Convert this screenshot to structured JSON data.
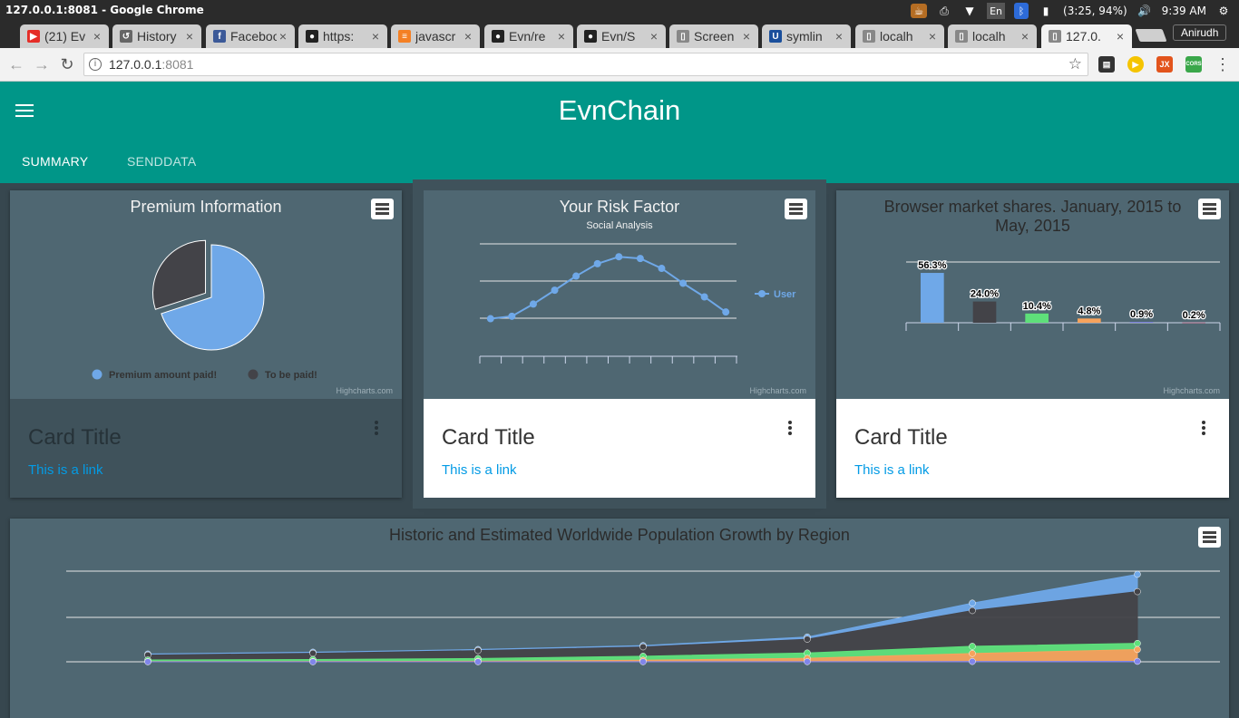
{
  "os": {
    "window_title": "127.0.0.1:8081 - Google Chrome",
    "keyboard": "En",
    "battery": "(3:25, 94%)",
    "clock": "9:39 AM"
  },
  "browser": {
    "tabs": [
      {
        "label": "(21) Ev",
        "icon": "youtube-icon",
        "color": "#e52d27",
        "glyph": "▶"
      },
      {
        "label": "History",
        "icon": "history-icon",
        "color": "#666666",
        "glyph": "↺"
      },
      {
        "label": "Facebook",
        "icon": "facebook-icon",
        "color": "#3b5998",
        "glyph": "f"
      },
      {
        "label": "https:",
        "icon": "github-icon",
        "color": "#222222",
        "glyph": "●"
      },
      {
        "label": "javascr",
        "icon": "stackoverflow-icon",
        "color": "#f48024",
        "glyph": "≡"
      },
      {
        "label": "Evn/re",
        "icon": "github-icon",
        "color": "#222222",
        "glyph": "●"
      },
      {
        "label": "Evn/S",
        "icon": "github-icon",
        "color": "#222222",
        "glyph": "●"
      },
      {
        "label": "Screen",
        "icon": "page-icon",
        "color": "#888888",
        "glyph": "▯"
      },
      {
        "label": "symlin",
        "icon": "unix-icon",
        "color": "#1a4f9c",
        "glyph": "U"
      },
      {
        "label": "localh",
        "icon": "page-icon",
        "color": "#888888",
        "glyph": "▯"
      },
      {
        "label": "localh",
        "icon": "page-icon",
        "color": "#888888",
        "glyph": "▯"
      },
      {
        "label": "127.0.",
        "icon": "page-icon",
        "color": "#888888",
        "glyph": "▯"
      }
    ],
    "profile": "Anirudh",
    "url_host": "127.0.0.1",
    "url_port": ":8081"
  },
  "app": {
    "title": "EvnChain",
    "tabs": [
      "SUMMARY",
      "SENDDATA"
    ]
  },
  "cards": [
    {
      "title": "Card Title",
      "link": "This is a link"
    },
    {
      "title": "Card Title",
      "link": "This is a link"
    },
    {
      "title": "Card Title",
      "link": "This is a link"
    }
  ],
  "credits": "Highcharts.com",
  "chart_data": [
    {
      "type": "pie",
      "title": "Premium Information",
      "categories": [
        "Premium amount paid!",
        "To be paid!"
      ],
      "values": [
        70,
        30
      ],
      "colors": [
        "#6fa8e8",
        "#434348"
      ]
    },
    {
      "type": "line",
      "title": "Your Risk Factor",
      "subtitle": "Social Analysis",
      "series": [
        {
          "name": "User",
          "values": [
            -0.2,
            0.8,
            5.7,
            11.3,
            17.0,
            22.0,
            24.8,
            24.1,
            20.1,
            14.1,
            8.6,
            2.5
          ]
        }
      ],
      "ylim": [
        -10,
        30
      ],
      "color": "#6fa8e8"
    },
    {
      "type": "bar",
      "title": "Browser market shares. January, 2015 to May, 2015",
      "values": [
        56.3,
        24.0,
        10.4,
        4.8,
        0.9,
        0.2
      ],
      "labels": [
        "56.3%",
        "24.0%",
        "10.4%",
        "4.8%",
        "0.9%",
        "0.2%"
      ],
      "colors": [
        "#6fa8e8",
        "#434348",
        "#5ee07a",
        "#f7a35c",
        "#8085e9",
        "#f15c80"
      ],
      "ylim": [
        0,
        70
      ]
    },
    {
      "type": "area",
      "title": "Historic and Estimated Worldwide Population Growth by Region",
      "series": [
        {
          "values": [
            106,
            107,
            111,
            133,
            221,
            767,
            1766
          ],
          "color": "#6fa8e8"
        },
        {
          "values": [
            502,
            635,
            809,
            947,
            1402,
            3634,
            5268
          ],
          "color": "#434348"
        },
        {
          "values": [
            163,
            203,
            276,
            408,
            547,
            729,
            628
          ],
          "color": "#5ee07a"
        },
        {
          "values": [
            18,
            31,
            54,
            156,
            339,
            818,
            1201
          ],
          "color": "#f7a35c"
        },
        {
          "values": [
            2,
            2,
            2,
            6,
            13,
            30,
            46
          ],
          "color": "#8085e9"
        }
      ]
    }
  ]
}
